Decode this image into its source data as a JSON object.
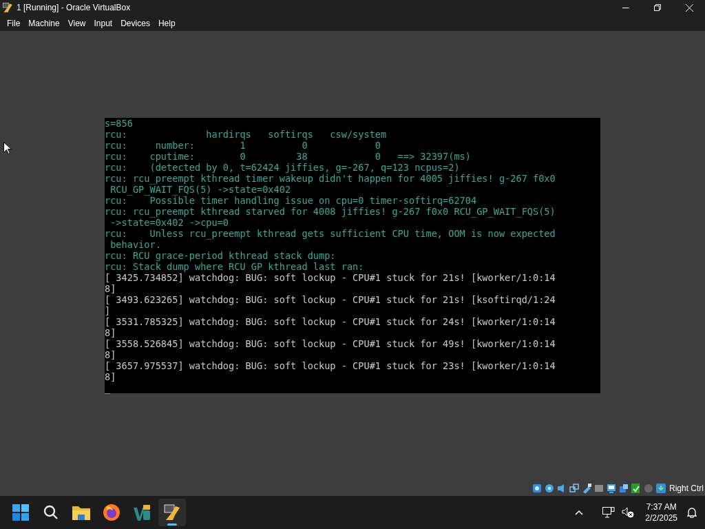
{
  "window": {
    "title": "1 [Running] - Oracle VirtualBox"
  },
  "menu": [
    "File",
    "Machine",
    "View",
    "Input",
    "Devices",
    "Help"
  ],
  "console": {
    "lines": [
      {
        "kind": "rcu",
        "text": "s=856"
      },
      {
        "kind": "rcu",
        "text": "rcu:              hardirqs   softirqs   csw/system"
      },
      {
        "kind": "rcu",
        "text": "rcu:     number:        1          0            0"
      },
      {
        "kind": "rcu",
        "text": "rcu:    cputime:        0         38            0   ==> 32397(ms)"
      },
      {
        "kind": "rcu",
        "text": "rcu:    (detected by 0, t=62424 jiffies, g=-267, q=123 ncpus=2)"
      },
      {
        "kind": "rcu",
        "text": "rcu: rcu_preempt kthread timer wakeup didn't happen for 4005 jiffies! g-267 f0x0"
      },
      {
        "kind": "rcu",
        "text": " RCU_GP_WAIT_FQS(5) ->state=0x402"
      },
      {
        "kind": "rcu",
        "text": "rcu:    Possible timer handling issue on cpu=0 timer-softirq=62704"
      },
      {
        "kind": "rcu",
        "text": "rcu: rcu_preempt kthread starved for 4008 jiffies! g-267 f0x0 RCU_GP_WAIT_FQS(5)"
      },
      {
        "kind": "rcu",
        "text": " ->state=0x402 ->cpu=0"
      },
      {
        "kind": "rcu",
        "text": "rcu:    Unless rcu_preempt kthread gets sufficient CPU time, OOM is now expected"
      },
      {
        "kind": "rcu",
        "text": " behavior."
      },
      {
        "kind": "rcu",
        "text": "rcu: RCU grace-period kthread stack dump:"
      },
      {
        "kind": "rcu",
        "text": "rcu: Stack dump where RCU GP kthread last ran:"
      },
      {
        "kind": "kernel",
        "text": "[ 3425.734852] watchdog: BUG: soft lockup - CPU#1 stuck for 21s! [kworker/1:0:14"
      },
      {
        "kind": "kernel",
        "text": "8]"
      },
      {
        "kind": "kernel",
        "text": "[ 3493.623265] watchdog: BUG: soft lockup - CPU#1 stuck for 21s! [ksoftirqd/1:24"
      },
      {
        "kind": "kernel",
        "text": "]"
      },
      {
        "kind": "kernel",
        "text": "[ 3531.785325] watchdog: BUG: soft lockup - CPU#1 stuck for 24s! [kworker/1:0:14"
      },
      {
        "kind": "kernel",
        "text": "8]"
      },
      {
        "kind": "kernel",
        "text": "[ 3558.526845] watchdog: BUG: soft lockup - CPU#1 stuck for 49s! [kworker/1:0:14"
      },
      {
        "kind": "kernel",
        "text": "8]"
      },
      {
        "kind": "kernel",
        "text": "[ 3657.975537] watchdog: BUG: soft lockup - CPU#1 stuck for 23s! [kworker/1:0:14"
      },
      {
        "kind": "kernel",
        "text": "8]"
      },
      {
        "kind": "cursor",
        "text": "_"
      }
    ]
  },
  "status_bar": {
    "host_key": "Right Ctrl"
  },
  "taskbar": {
    "apps": [
      {
        "kind": "start",
        "selected": false
      },
      {
        "kind": "search",
        "selected": false
      },
      {
        "kind": "folder",
        "selected": false
      },
      {
        "kind": "browser",
        "selected": false
      },
      {
        "kind": "editor",
        "selected": false
      },
      {
        "kind": "virtualbox",
        "selected": true
      }
    ],
    "time": "7:37 AM",
    "date": "2/2/2025"
  }
}
